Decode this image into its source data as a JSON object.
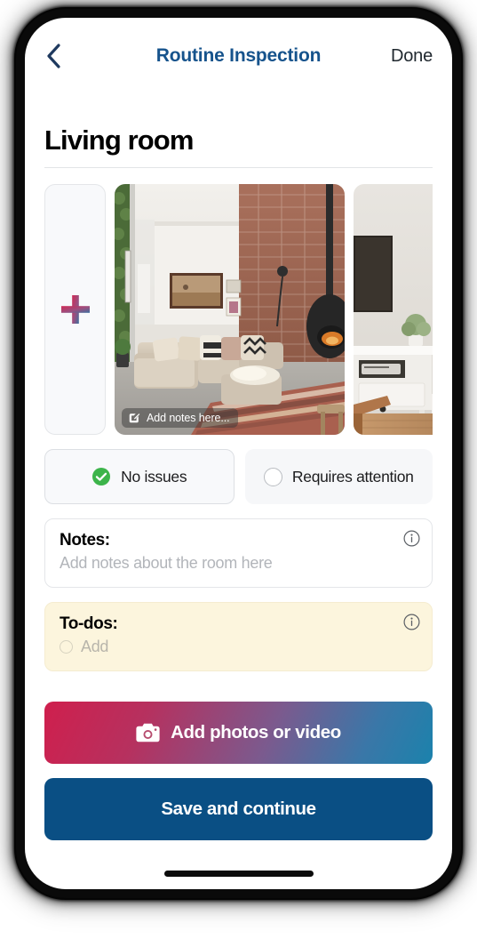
{
  "navbar": {
    "back_icon": "chevron-left-icon",
    "title": "Routine Inspection",
    "done_label": "Done"
  },
  "page": {
    "room_title": "Living room"
  },
  "photos": {
    "add_tile_icon": "plus-icon",
    "items": [
      {
        "alt": "Living room with exposed brick wall, hanging fireplace, sectional sofa and striped rug",
        "note_icon": "edit-note-icon",
        "note_label": "Add notes here..."
      },
      {
        "alt": "White TV console with plant and wall-mounted television"
      }
    ]
  },
  "status": {
    "options": [
      {
        "label": "No issues",
        "icon": "check-circle-icon",
        "selected": true
      },
      {
        "label": "Requires attention",
        "icon": "empty-circle-icon",
        "selected": false
      }
    ]
  },
  "notes": {
    "label": "Notes:",
    "placeholder": "Add notes about the room here",
    "info_icon": "info-icon",
    "value": ""
  },
  "todos": {
    "label": "To-dos:",
    "add_label": "Add",
    "info_icon": "info-icon",
    "items": []
  },
  "actions": {
    "add_photos_label": "Add photos or video",
    "add_photos_icon": "camera-icon",
    "save_label": "Save and continue"
  },
  "colors": {
    "brand_navy": "#16538c",
    "save_button": "#0a4f84",
    "gradient_start": "#cf1f4d",
    "gradient_end": "#1b82ac",
    "success_green": "#3cb44a",
    "todos_background": "#fcf5dd"
  }
}
